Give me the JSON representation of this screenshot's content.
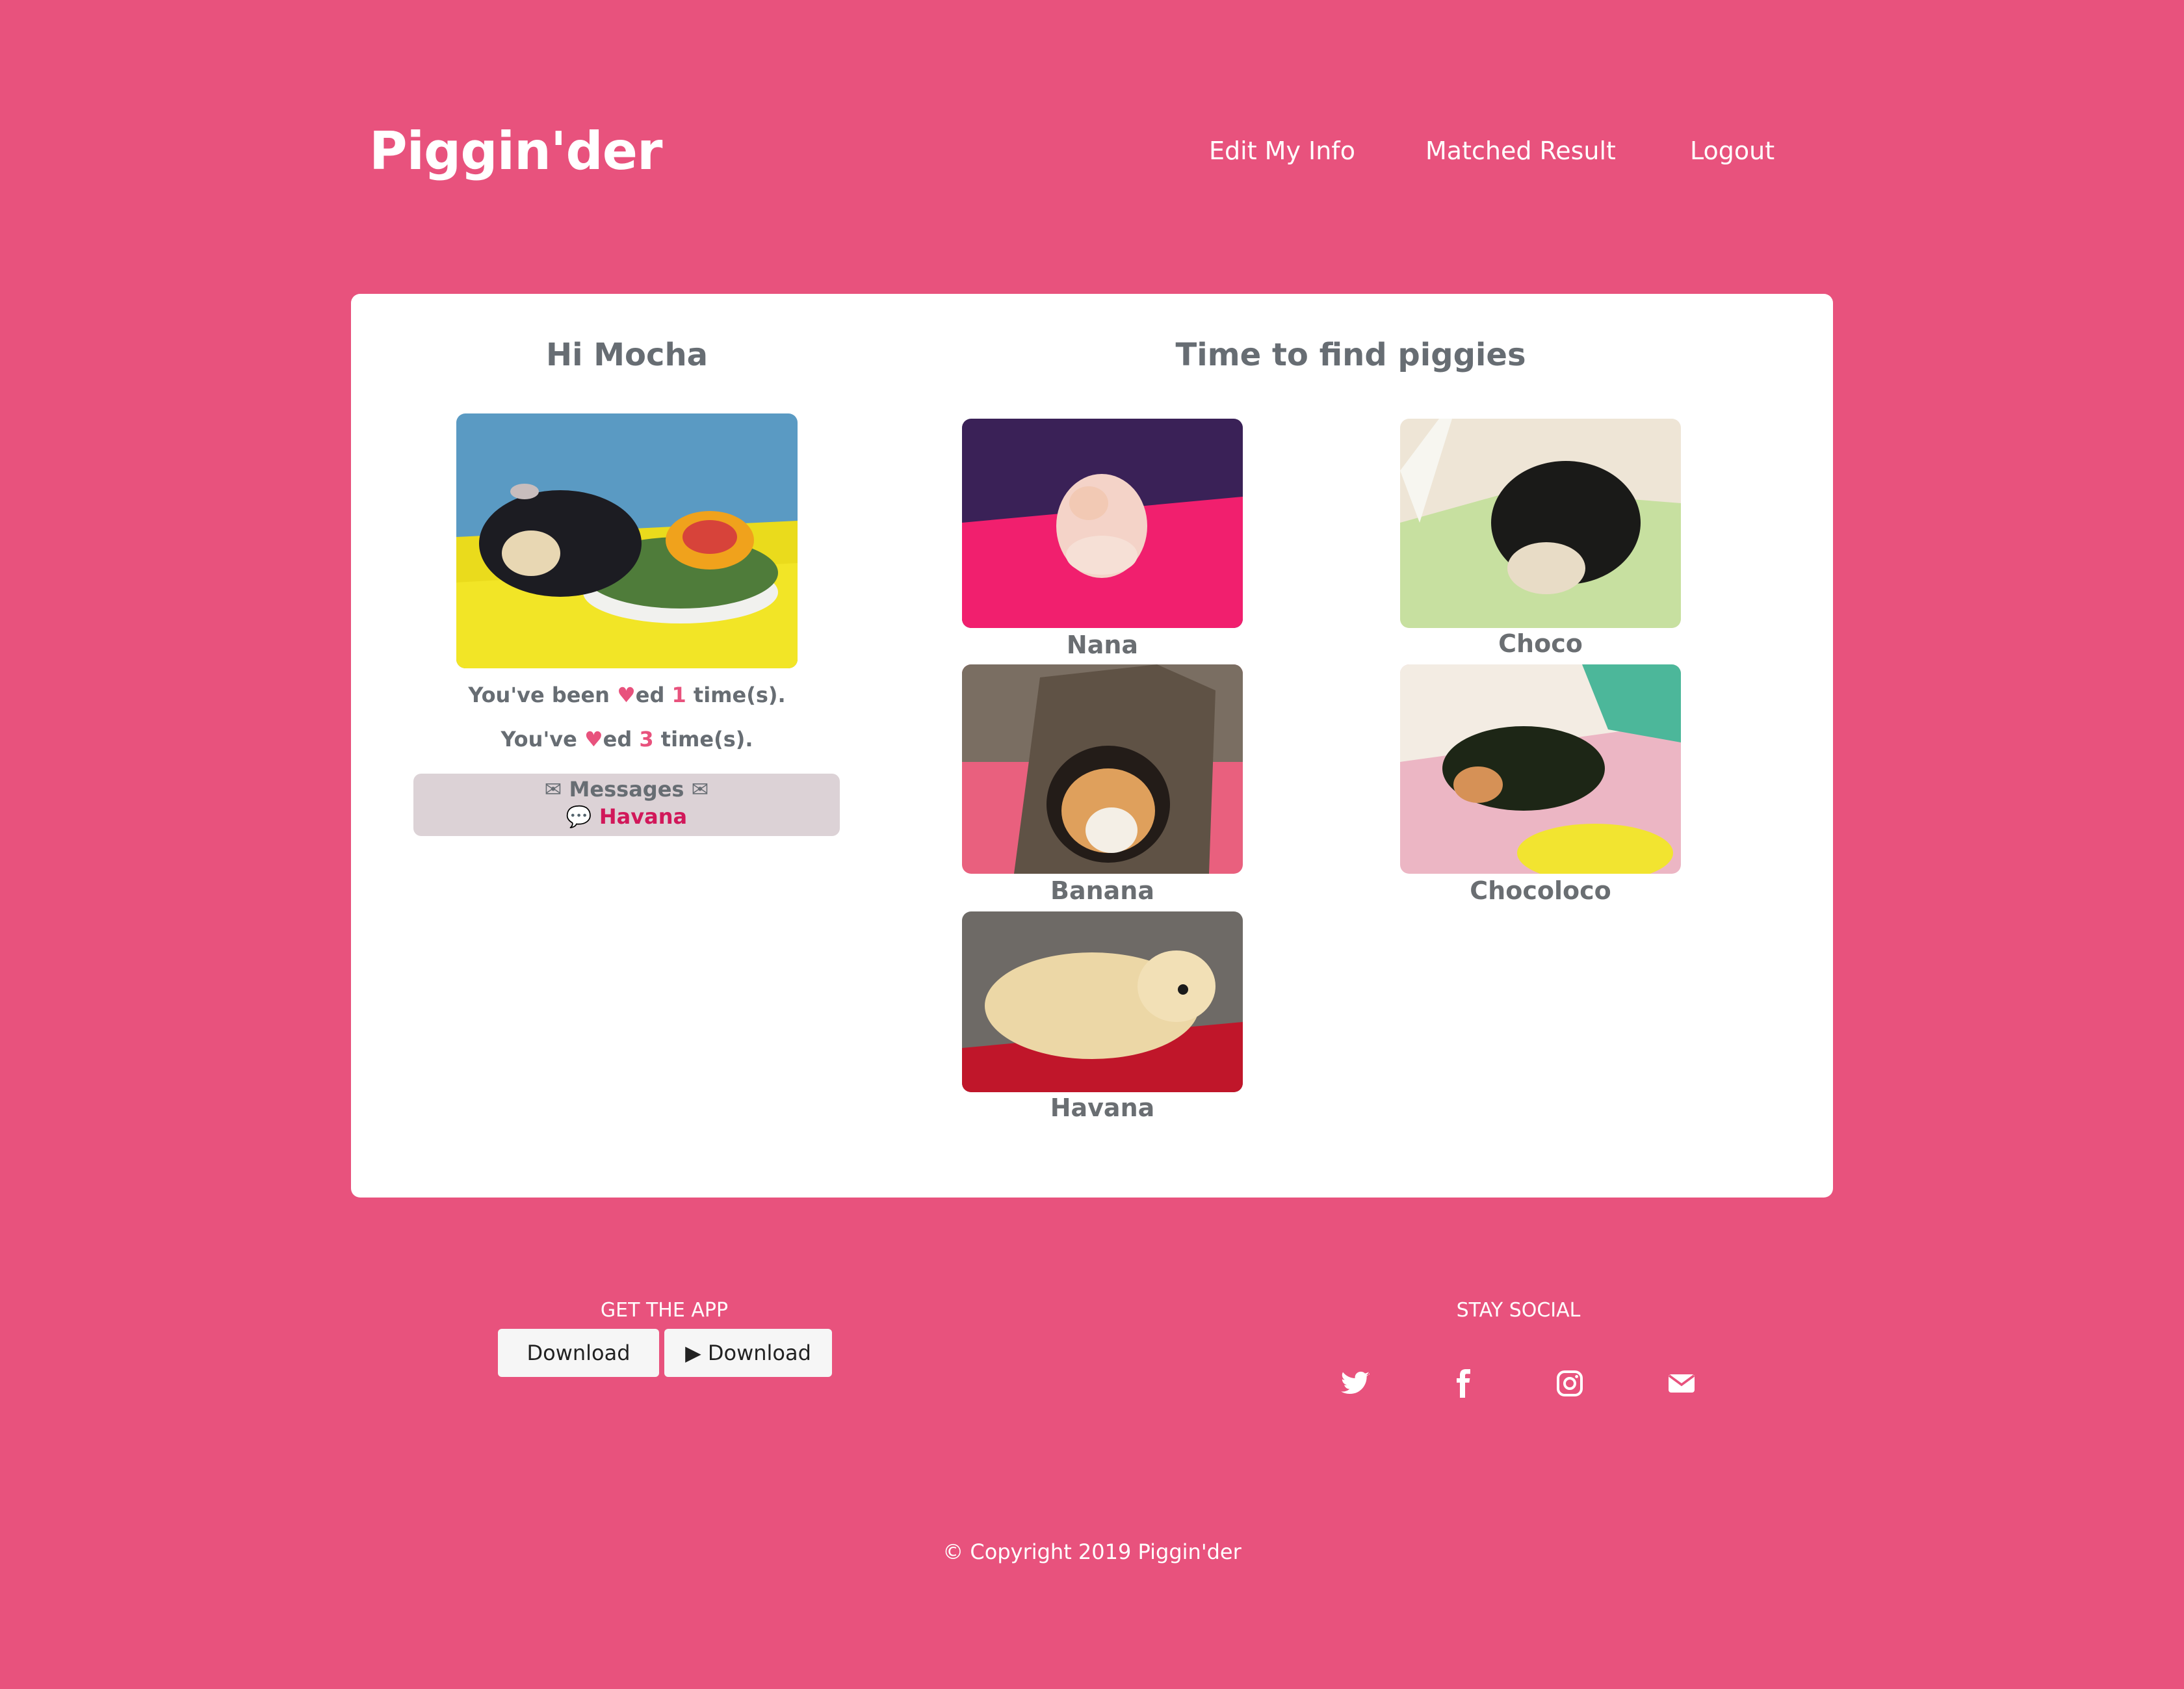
{
  "header": {
    "brand": "Piggin'der",
    "nav": {
      "edit": "Edit My Info",
      "matched": "Matched Result",
      "logout": "Logout"
    }
  },
  "profile": {
    "greeting": "Hi Mocha",
    "been_liked_prefix": "You've been ",
    "been_liked_suffix": "ed ",
    "been_liked_count": "1",
    "been_liked_unit": " time(s).",
    "liked_prefix": "You've ",
    "liked_suffix": "ed ",
    "liked_count": "3",
    "liked_unit": " time(s).",
    "messages_label": "Messages",
    "message_from": "Havana"
  },
  "find": {
    "title": "Time to find piggies",
    "piggies": [
      "Nana",
      "Choco",
      "Banana",
      "Chocoloco",
      "Havana"
    ]
  },
  "footer": {
    "get_app": "GET THE APP",
    "download_ios": "Download",
    "download_android": "Download",
    "stay_social": "STAY SOCIAL",
    "copyright": "© Copyright 2019 Piggin'der"
  },
  "colors": {
    "background": "#e8527d",
    "card": "#ffffff",
    "heading": "#676d73",
    "accent": "#d1185a"
  },
  "icons": [
    "heart-icon",
    "envelope-icon",
    "comment-icon",
    "apple-icon",
    "google-play-icon",
    "twitter-icon",
    "facebook-icon",
    "instagram-icon",
    "mail-icon"
  ]
}
